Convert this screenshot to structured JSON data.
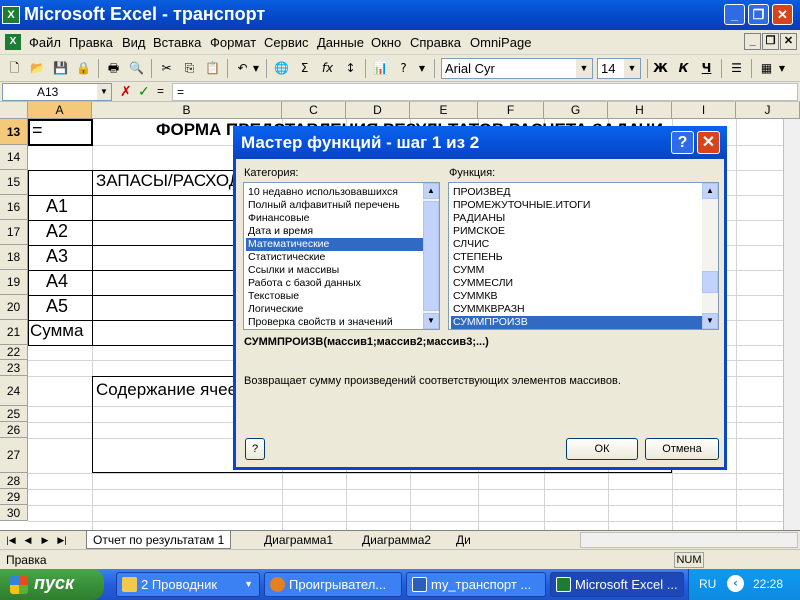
{
  "window": {
    "title": "Microsoft Excel - транспорт",
    "icon": "excel-icon"
  },
  "menu": {
    "items": [
      "Файл",
      "Правка",
      "Вид",
      "Вставка",
      "Формат",
      "Сервис",
      "Данные",
      "Окно",
      "Справка",
      "OmniPage"
    ]
  },
  "toolbar": {
    "font_name": "Arial Cyr",
    "font_size": "14",
    "bold": "Ж",
    "italic": "К",
    "underline": "Ч"
  },
  "formula_bar": {
    "name_box": "A13",
    "equals": "=",
    "formula": "="
  },
  "grid": {
    "columns": [
      "A",
      "B",
      "C",
      "D",
      "E",
      "F",
      "G",
      "H",
      "I",
      "J"
    ],
    "rows": [
      "13",
      "14",
      "15",
      "16",
      "17",
      "18",
      "19",
      "20",
      "21",
      "22",
      "23",
      "24",
      "25",
      "26",
      "27",
      "28",
      "29",
      "30"
    ],
    "cells": {
      "a13": "=",
      "b13": "ФОРМА ПРЕДСТАВЛЕНИЯ РЕЗУЛЬТАТОВ РАСЧЕТА ЗАДАЧИ",
      "b15": "ЗАПАСЫ/РАСХОДЫ",
      "a16": "А1",
      "a17": "А2",
      "a18": "А3",
      "a19": "А4",
      "a20": "А5",
      "a21": "Сумма",
      "b24": "Содержание ячеек"
    }
  },
  "sheet_tabs": [
    "Отчет по результатам 1",
    "Диаграмма1",
    "Диаграмма2",
    "Ди"
  ],
  "status": {
    "left": "Правка",
    "num": "NUM"
  },
  "taskbar": {
    "start": "пуск",
    "tasks": [
      "2 Проводник",
      "Проигрывател...",
      "my_транспорт ...",
      "Microsoft Excel ..."
    ],
    "lang": "RU",
    "clock": "22:28"
  },
  "dialog": {
    "title": "Мастер функций - шаг 1 из 2",
    "category_label": "Категория:",
    "function_label": "Функция:",
    "categories": [
      "10 недавно использовавшихся",
      "Полный алфавитный перечень",
      "Финансовые",
      "Дата и время",
      "Математические",
      "Статистические",
      "Ссылки и массивы",
      "Работа с базой данных",
      "Текстовые",
      "Логические",
      "Проверка свойств и значений"
    ],
    "selected_category": "Математические",
    "functions": [
      "ПРОИЗВЕД",
      "ПРОМЕЖУТОЧНЫЕ.ИТОГИ",
      "РАДИАНЫ",
      "РИМСКОЕ",
      "СЛЧИС",
      "СТЕПЕНЬ",
      "СУММ",
      "СУММЕСЛИ",
      "СУММКВ",
      "СУММКВРАЗН",
      "СУММПРОИЗВ"
    ],
    "selected_function": "СУММПРОИЗВ",
    "syntax": "СУММПРОИЗВ(массив1;массив2;массив3;...)",
    "description": "Возвращает сумму произведений соответствующих элементов массивов.",
    "ok": "ОК",
    "cancel": "Отмена",
    "help_icon": "?"
  },
  "colors": {
    "title_blue": "#0a5ee0",
    "selection": "#316ac5",
    "close_red": "#d8431c",
    "start_green": "#3a913a"
  }
}
